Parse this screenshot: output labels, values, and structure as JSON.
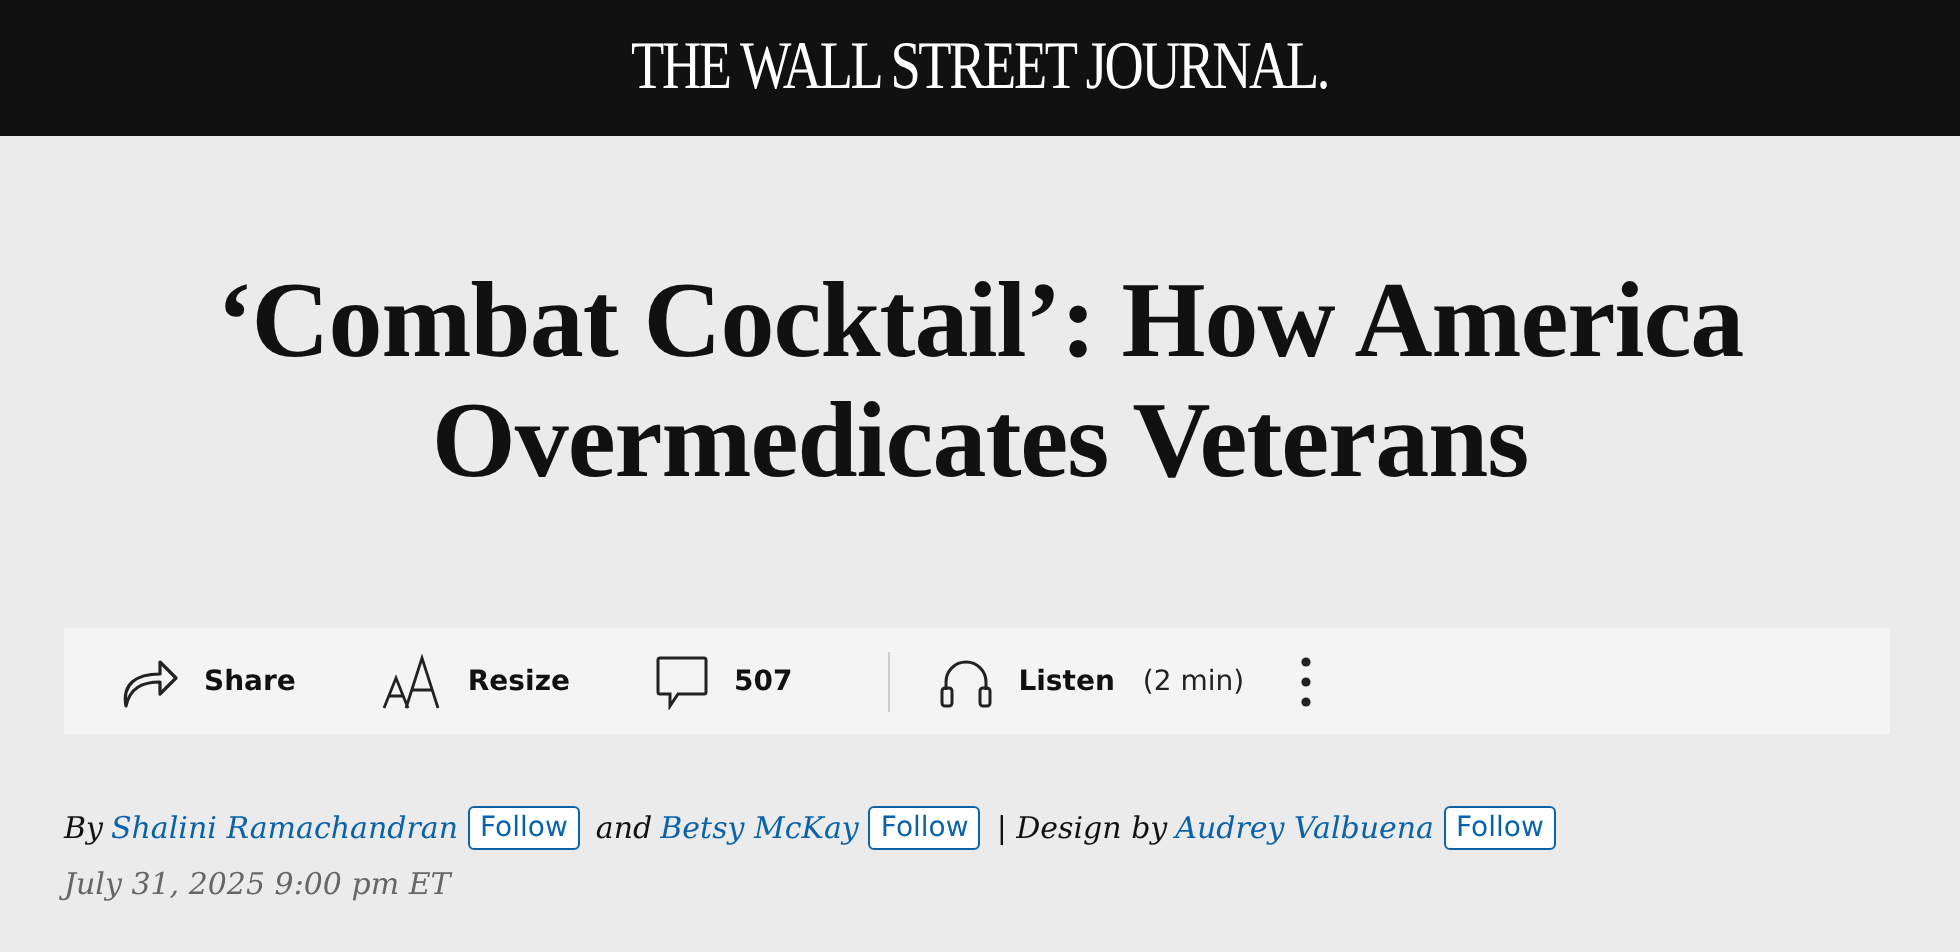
{
  "masthead": {
    "logo": "THE WALL STREET JOURNAL."
  },
  "headline": "‘Combat Cocktail’: How America Overmedicates Veterans",
  "toolbar": [
    {
      "kind": "share",
      "label": "Share"
    },
    {
      "kind": "resize",
      "label": "Resize"
    },
    {
      "kind": "comments",
      "label": "507"
    },
    {
      "kind": "listen",
      "label": "Listen",
      "note": "(2 min)"
    },
    {
      "kind": "more"
    }
  ],
  "byline": [
    {
      "prefix": "By",
      "name": "Shalini Ramachandran",
      "follow": "Follow"
    },
    {
      "prefix": "and",
      "name": "Betsy McKay",
      "follow": "Follow"
    },
    {
      "prefix": "| Design by",
      "name": "Audrey Valbuena",
      "follow": "Follow"
    }
  ],
  "date": "July 31, 2025 9:00 pm ET"
}
